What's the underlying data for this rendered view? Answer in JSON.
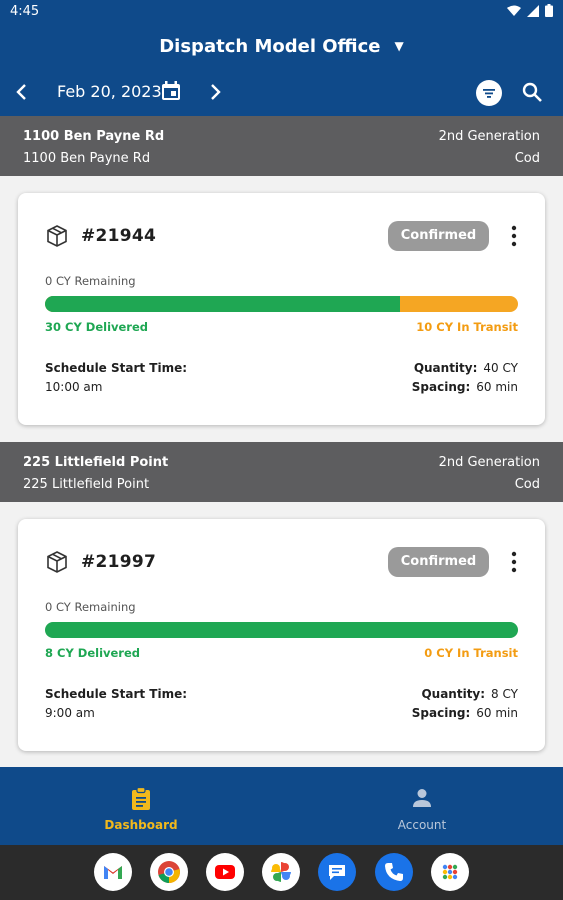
{
  "status_bar": {
    "time": "4:45"
  },
  "header": {
    "office": "Dispatch Model Office",
    "date": "Feb 20, 2023"
  },
  "jobs": [
    {
      "address_line1": "1100 Ben Payne Rd",
      "address_line2": "1100 Ben Payne Rd",
      "generation": "2nd Generation",
      "payment": "Cod",
      "order": {
        "number": "#21944",
        "status": "Confirmed",
        "remaining": "0 CY Remaining",
        "delivered_label": "30 CY Delivered",
        "transit_label": "10 CY In Transit",
        "delivered_fraction": 0.75,
        "schedule_label": "Schedule Start Time:",
        "schedule_time": "10:00 am",
        "quantity_label": "Quantity:",
        "quantity": "40 CY",
        "spacing_label": "Spacing:",
        "spacing": "60 min"
      }
    },
    {
      "address_line1": "225 Littlefield Point",
      "address_line2": "225 Littlefield Point",
      "generation": "2nd Generation",
      "payment": "Cod",
      "order": {
        "number": "#21997",
        "status": "Confirmed",
        "remaining": "0 CY Remaining",
        "delivered_label": "8 CY Delivered",
        "transit_label": "0 CY In Transit",
        "delivered_fraction": 1.0,
        "schedule_label": "Schedule Start Time:",
        "schedule_time": "9:00 am",
        "quantity_label": "Quantity:",
        "quantity": "8 CY",
        "spacing_label": "Spacing:",
        "spacing": "60 min"
      }
    }
  ],
  "bottom_nav": {
    "dashboard": "Dashboard",
    "account": "Account",
    "active_color": "#f2b91c",
    "inactive_color": "#b9c7da"
  },
  "dock": [
    "gmail-icon",
    "chrome-icon",
    "youtube-icon",
    "photos-icon",
    "messages-icon",
    "phone-icon",
    "app-drawer-icon"
  ],
  "colors": {
    "brand": "#0f4a8a",
    "delivered": "#1fa753",
    "transit": "#f39c12",
    "job_header": "#5d5d5f"
  }
}
